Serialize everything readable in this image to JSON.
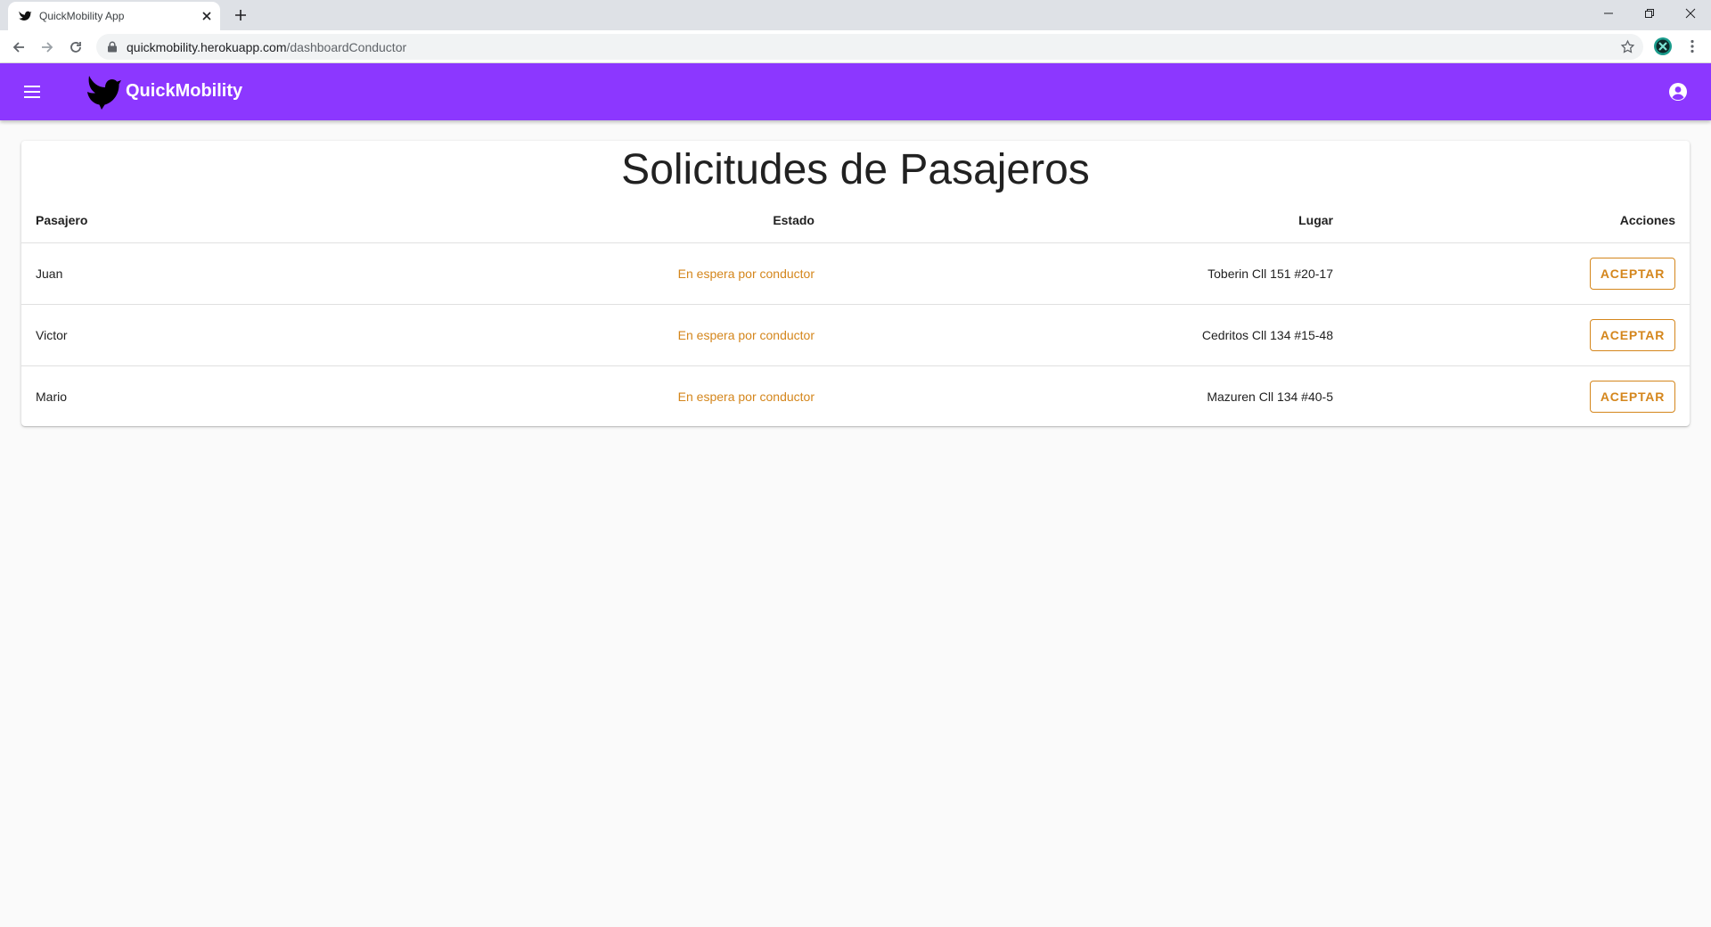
{
  "browser": {
    "tab_title": "QuickMobility App",
    "url_host": "quickmobility.herokuapp.com",
    "url_path": "/dashboardConductor"
  },
  "app": {
    "brand": "QuickMobility",
    "primary_color": "#8c37ff",
    "accent_color": "#d4861c",
    "icons": [
      "menu-icon",
      "bird-logo",
      "account-circle-icon"
    ]
  },
  "page": {
    "title": "Solicitudes de Pasajeros",
    "columns": [
      "Pasajero",
      "Estado",
      "Lugar",
      "Acciones"
    ],
    "rows": [
      {
        "pasajero": "Juan",
        "estado": "En espera por conductor",
        "lugar": "Toberin Cll 151 #20-17",
        "accion": "ACEPTAR"
      },
      {
        "pasajero": "Victor",
        "estado": "En espera por conductor",
        "lugar": "Cedritos Cll 134 #15-48",
        "accion": "ACEPTAR"
      },
      {
        "pasajero": "Mario",
        "estado": "En espera por conductor",
        "lugar": "Mazuren Cll 134 #40-5",
        "accion": "ACEPTAR"
      }
    ]
  }
}
